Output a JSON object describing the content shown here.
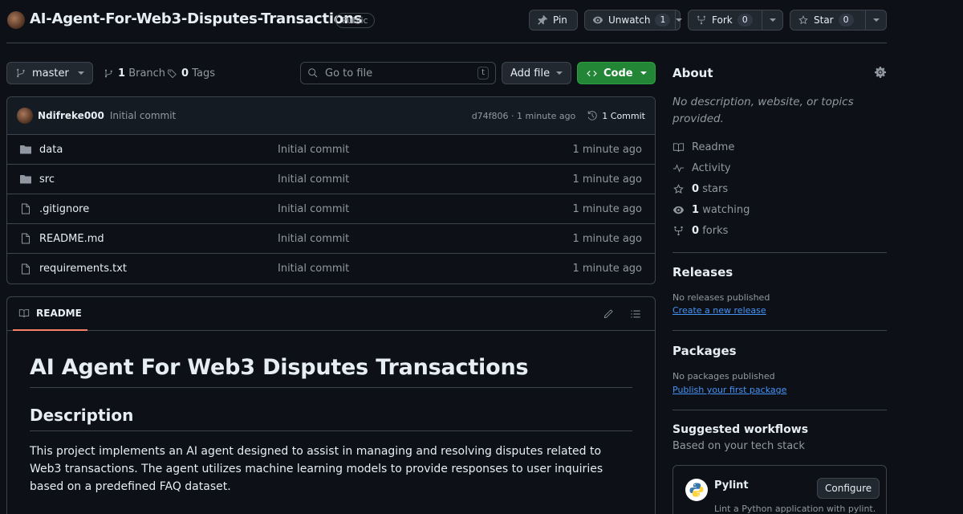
{
  "repo": {
    "name": "AI-Agent-For-Web3-Disputes-Transactions",
    "visibility": "Public"
  },
  "header_actions": {
    "pin": "Pin",
    "unwatch": "Unwatch",
    "watch_count": "1",
    "fork": "Fork",
    "fork_count": "0",
    "star": "Star",
    "star_count": "0"
  },
  "toolbar": {
    "branch": "master",
    "branches_num": "1",
    "branches_label": "Branch",
    "tags_num": "0",
    "tags_label": "Tags",
    "goto_placeholder": "Go to file",
    "goto_shortcut": "t",
    "add_file": "Add file",
    "code": "Code"
  },
  "latest_commit": {
    "author": "Ndifreke000",
    "message": "Initial commit",
    "meta": "d74f806 · 1 minute ago",
    "count": "1 Commit"
  },
  "files": [
    {
      "name": "data",
      "type": "folder",
      "message": "Initial commit",
      "time": "1 minute ago"
    },
    {
      "name": "src",
      "type": "folder",
      "message": "Initial commit",
      "time": "1 minute ago"
    },
    {
      "name": ".gitignore",
      "type": "file",
      "message": "Initial commit",
      "time": "1 minute ago"
    },
    {
      "name": "README.md",
      "type": "file",
      "message": "Initial commit",
      "time": "1 minute ago"
    },
    {
      "name": "requirements.txt",
      "type": "file",
      "message": "Initial commit",
      "time": "1 minute ago"
    }
  ],
  "readme": {
    "tab": "README",
    "h1": "AI Agent For Web3 Disputes Transactions",
    "h2": "Description",
    "paragraph": "This project implements an AI agent designed to assist in managing and resolving disputes related to Web3 transactions. The agent utilizes machine learning models to provide responses to user inquiries based on a predefined FAQ dataset."
  },
  "about": {
    "title": "About",
    "description": "No description, website, or topics provided.",
    "readme": "Readme",
    "activity": "Activity",
    "stars_num": "0",
    "stars_label": "stars",
    "watching_num": "1",
    "watching_label": "watching",
    "forks_num": "0",
    "forks_label": "forks"
  },
  "releases": {
    "title": "Releases",
    "note": "No releases published",
    "link": "Create a new release"
  },
  "packages": {
    "title": "Packages",
    "note": "No packages published",
    "link": "Publish your first package"
  },
  "workflows": {
    "title": "Suggested workflows",
    "subtitle": "Based on your tech stack",
    "item_name": "Pylint",
    "configure": "Configure",
    "item_desc": "Lint a Python application with pylint."
  },
  "colors": {
    "background": "#0d1117",
    "border": "#3d444d",
    "code_button": "#238636",
    "link": "#4493f8",
    "tab_underline": "#f78166"
  }
}
